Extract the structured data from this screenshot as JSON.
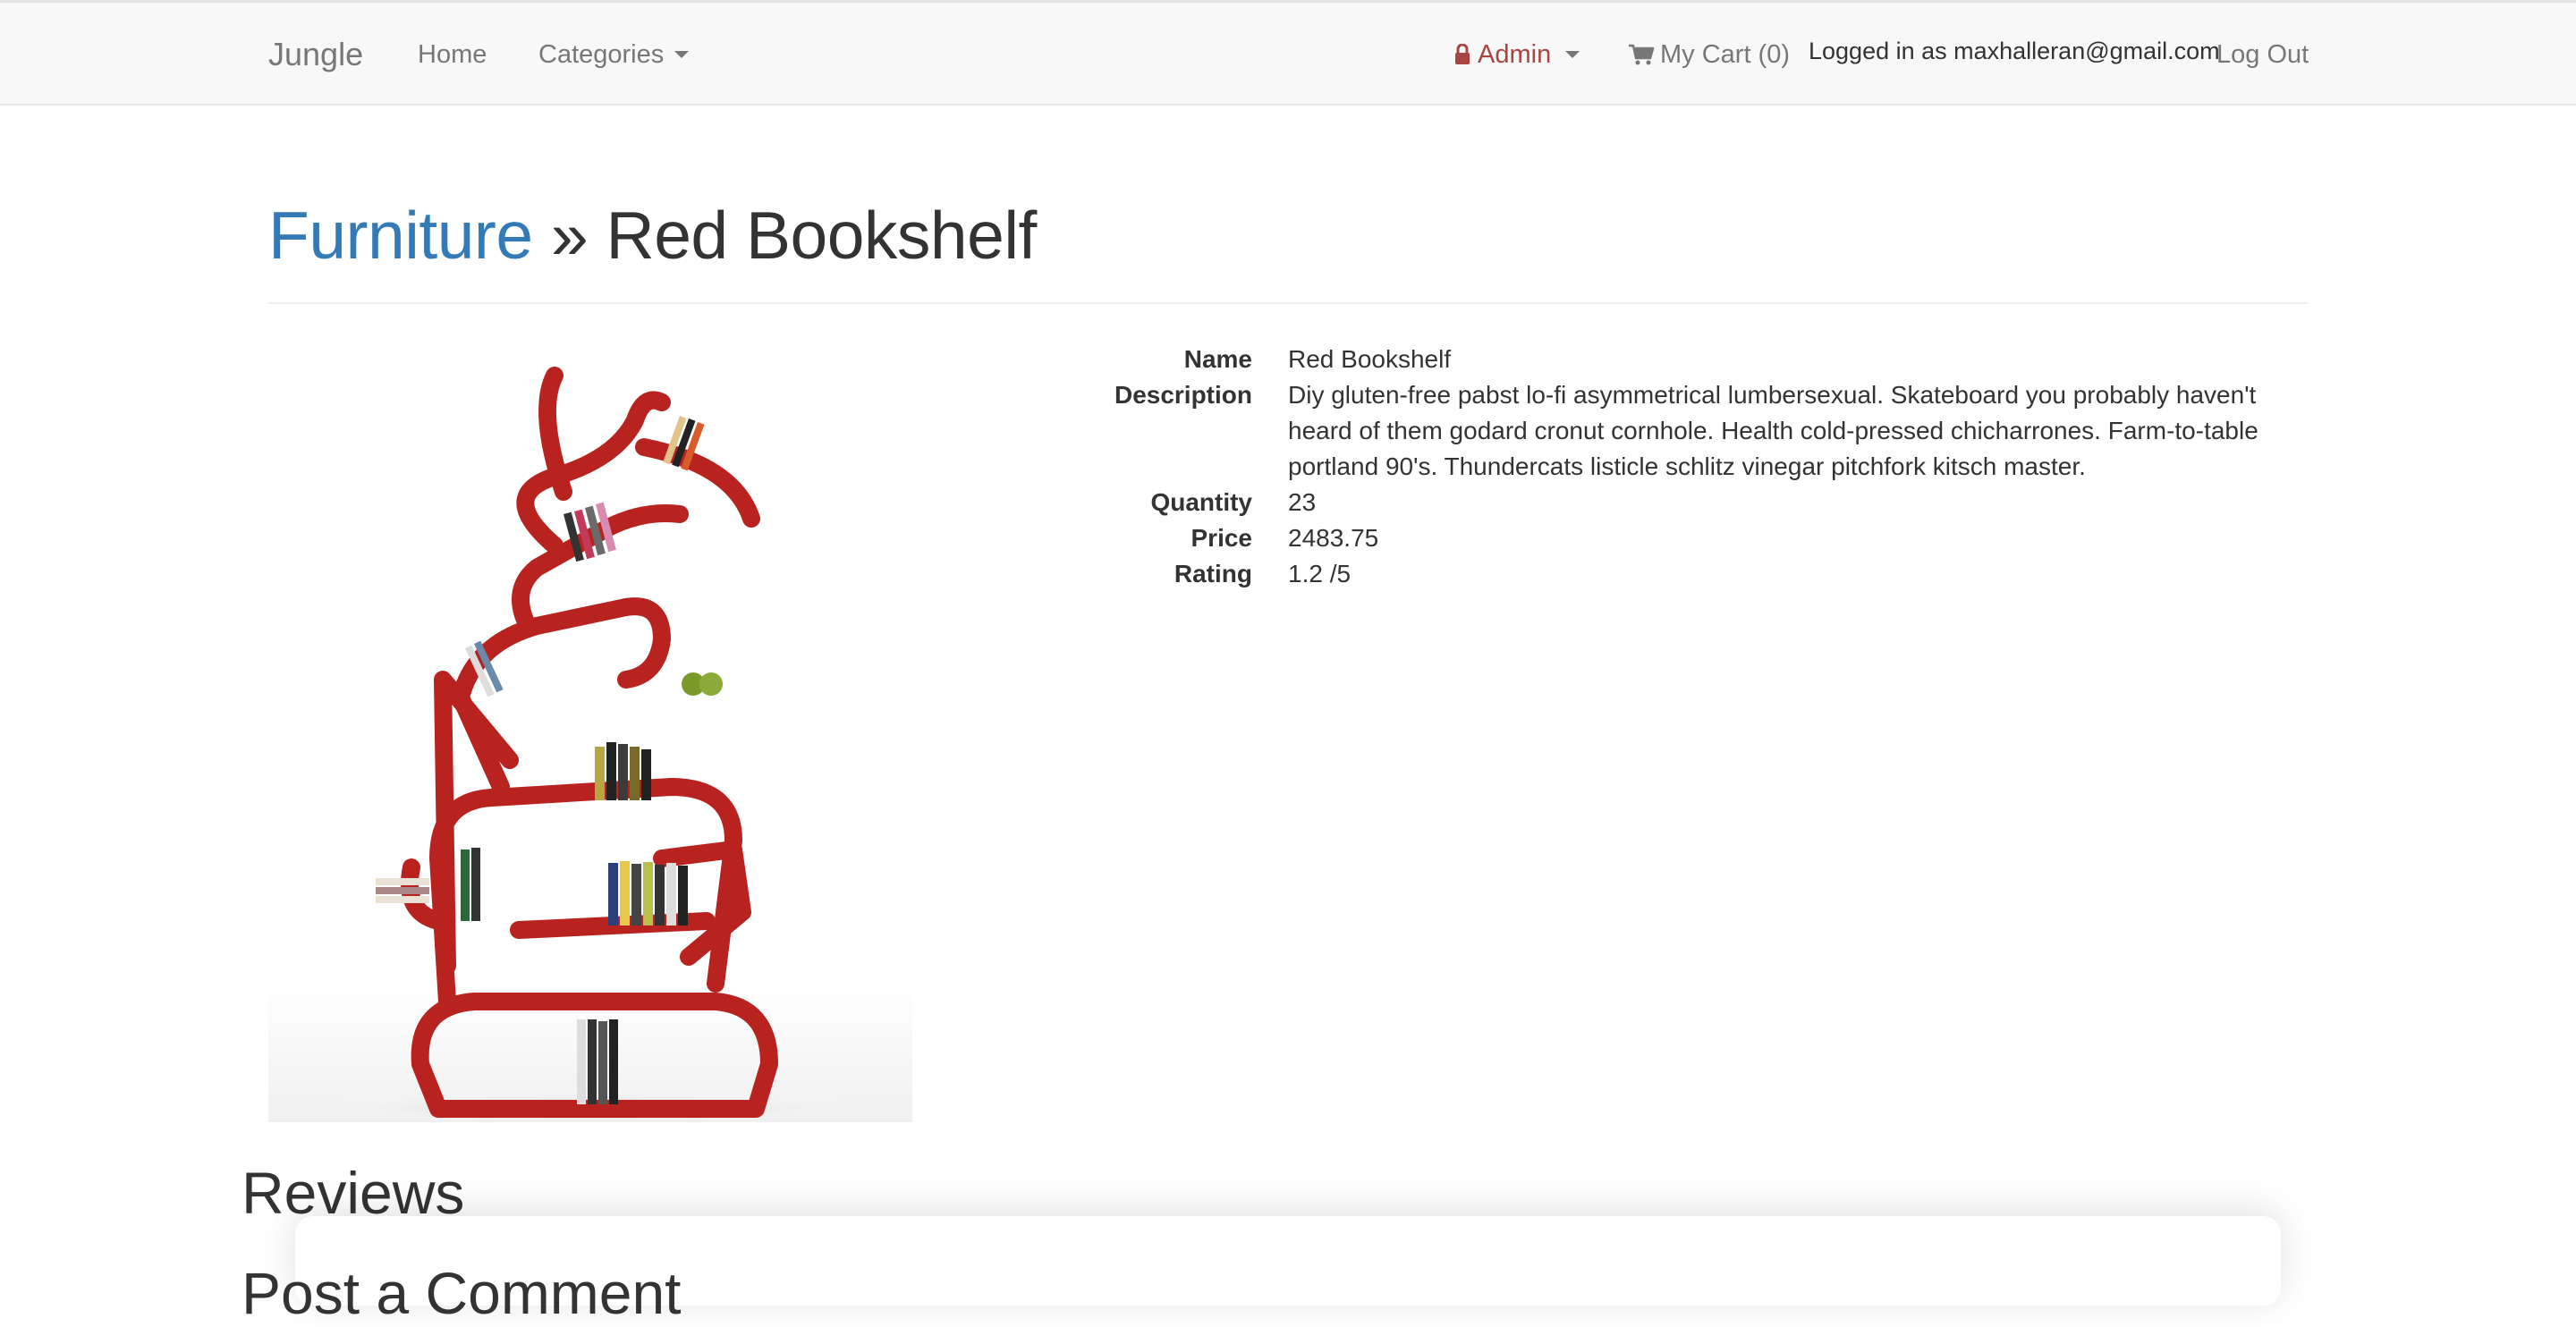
{
  "navbar": {
    "brand": "Jungle",
    "home": "Home",
    "categories": "Categories",
    "admin": "Admin",
    "cart": "My Cart (0)",
    "logged_in": "Logged in as maxhalleran@gmail.com",
    "logout": "Log Out",
    "icons": [
      "lock-icon",
      "cart-icon",
      "caret-down-icon"
    ],
    "colors": {
      "admin": "#a94442",
      "link": "#337ab7"
    }
  },
  "header": {
    "category": "Furniture",
    "separator": "»",
    "product": "Red Bookshelf"
  },
  "product": {
    "name_label": "Name",
    "name": "Red Bookshelf",
    "description_label": "Description",
    "description": "Diy gluten-free pabst lo-fi asymmetrical lumbersexual. Skateboard you probably haven't heard of them godard cronut cornhole. Health cold-pressed chicharrones. Farm-to-table portland 90's. Thundercats listicle schlitz vinegar pitchfork kitsch master.",
    "quantity_label": "Quantity",
    "quantity": "23",
    "price_label": "Price",
    "price": "2483.75",
    "rating_label": "Rating",
    "rating": "1.2 /5"
  },
  "reviews": {
    "title": "Reviews",
    "subtitle": "Post a Comment"
  }
}
